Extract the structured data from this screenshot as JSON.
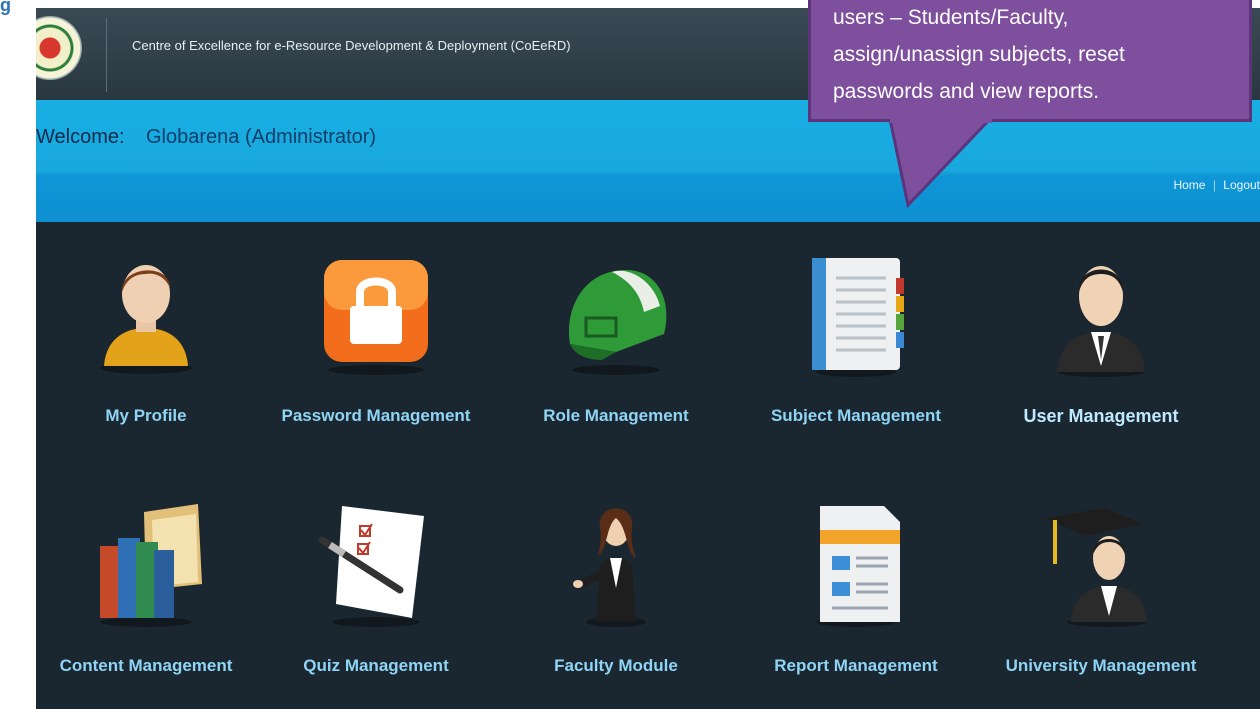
{
  "header": {
    "site_title": "Centre of Excellence for e-Resource Development & Deployment (CoEeRD)"
  },
  "welcome": {
    "label": "Welcome:",
    "user": "Globarena (Administrator)"
  },
  "top_links": {
    "home": "Home",
    "separator": "|",
    "logout": "Logout"
  },
  "tiles": [
    {
      "label": "My Profile",
      "icon": "user-profile-icon"
    },
    {
      "label": "Password Management",
      "icon": "padlock-icon"
    },
    {
      "label": "Role Management",
      "icon": "green-cap-icon"
    },
    {
      "label": "Subject Management",
      "icon": "notebook-icon"
    },
    {
      "label": "User Management",
      "icon": "businessman-icon"
    },
    {
      "label": "Content Management",
      "icon": "books-folders-icon"
    },
    {
      "label": "Quiz Management",
      "icon": "checklist-pen-icon"
    },
    {
      "label": "Faculty Module",
      "icon": "woman-presenter-icon"
    },
    {
      "label": "Report Management",
      "icon": "report-document-icon"
    },
    {
      "label": "University Management",
      "icon": "graduate-icon"
    }
  ],
  "callout": {
    "lines": [
      "users – Students/Faculty,",
      "assign/unassign subjects, reset",
      "passwords and view reports."
    ]
  },
  "colors": {
    "header_bg": "#2f3d46",
    "welcome_bar": "#19aee3",
    "panel_bg": "#1b2730",
    "tile_label": "#8fd4f4",
    "callout_bg": "#7d4f9d"
  }
}
